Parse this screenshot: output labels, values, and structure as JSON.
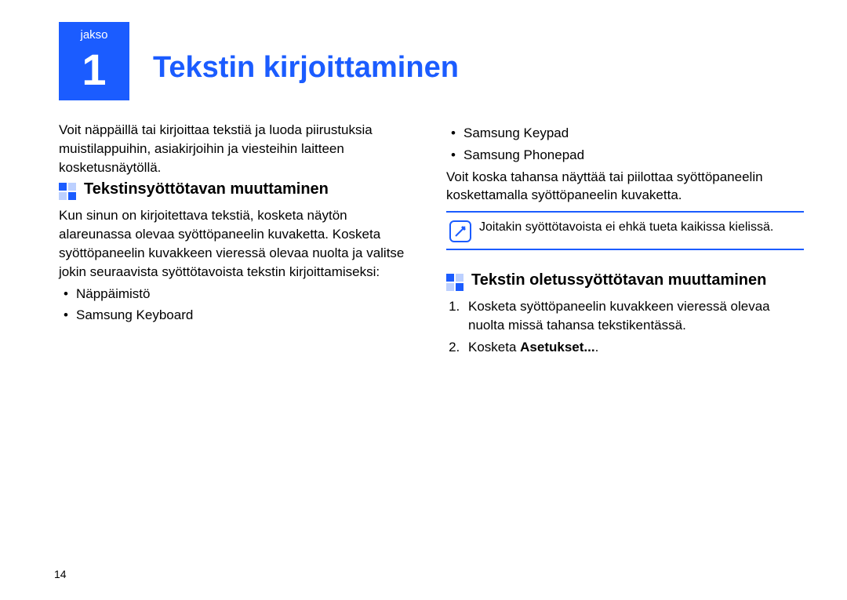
{
  "chapter": {
    "label": "jakso",
    "number": "1",
    "title": "Tekstin kirjoittaminen"
  },
  "left": {
    "intro": "Voit näppäillä tai kirjoittaa tekstiä ja luoda piirustuksia muistilappuihin, asiakirjoihin ja viesteihin laitteen kosketusnäytöllä.",
    "section1": {
      "title": "Tekstinsyöttötavan muuttaminen",
      "body": "Kun sinun on kirjoitettava tekstiä, kosketa näytön alareunassa olevaa syöttöpaneelin kuvaketta. Kosketa syöttöpaneelin kuvakkeen vieressä olevaa nuolta ja valitse jokin seuraavista syöttötavoista tekstin kirjoittamiseksi:",
      "bullets": [
        "Näppäimistö",
        "Samsung Keyboard"
      ]
    }
  },
  "right": {
    "bullets_cont": [
      "Samsung Keypad",
      "Samsung Phonepad"
    ],
    "body": "Voit koska tahansa näyttää tai piilottaa syöttöpaneelin koskettamalla syöttöpaneelin kuvaketta.",
    "note": "Joitakin syöttötavoista ei ehkä tueta kaikissa kielissä.",
    "section2": {
      "title": "Tekstin oletussyöttötavan muuttaminen",
      "step1": "Kosketa syöttöpaneelin kuvakkeen vieressä olevaa nuolta missä tahansa tekstikentässä.",
      "step2_prefix": "Kosketa ",
      "step2_bold": "Asetukset..."
    }
  },
  "page_number": "14"
}
